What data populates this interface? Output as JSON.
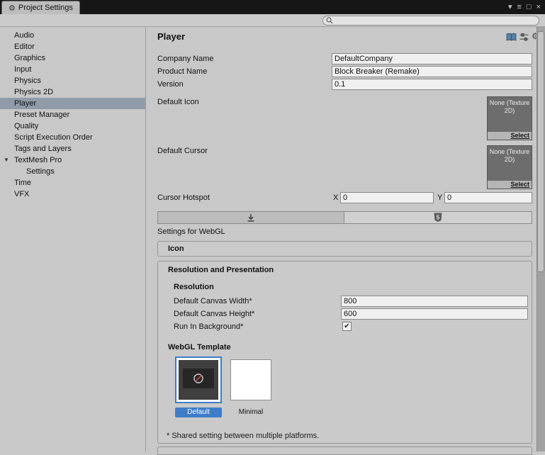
{
  "colors": {
    "selection_blue": "#3e7cc8",
    "sidebar_selection": "#8f9ba8"
  },
  "titlebar": {
    "tab_label": "Project Settings",
    "gear_glyph": "⚙",
    "caret_glyph": "▾",
    "menu_glyph": "≡",
    "maximize_glyph": "□",
    "close_glyph": "×"
  },
  "toolbar": {
    "search_value": ""
  },
  "sidebar": {
    "items": [
      {
        "label": "Audio"
      },
      {
        "label": "Editor"
      },
      {
        "label": "Graphics"
      },
      {
        "label": "Input"
      },
      {
        "label": "Physics"
      },
      {
        "label": "Physics 2D"
      },
      {
        "label": "Player"
      },
      {
        "label": "Preset Manager"
      },
      {
        "label": "Quality"
      },
      {
        "label": "Script Execution Order"
      },
      {
        "label": "Tags and Layers"
      },
      {
        "label": "TextMesh Pro",
        "foldout": "▼"
      },
      {
        "label": "Settings"
      },
      {
        "label": "Time"
      },
      {
        "label": "VFX"
      }
    ]
  },
  "main": {
    "title": "Player",
    "rows": [
      {
        "label": "Company Name",
        "value": "DefaultCompany"
      },
      {
        "label": "Product Name",
        "value": "Block Breaker (Remake)"
      },
      {
        "label": "Version",
        "value": "0.1"
      }
    ],
    "default_icon_label": "Default Icon",
    "default_cursor_label": "Default Cursor",
    "none_texture_text": "None (Texture 2D)",
    "select_label": "Select",
    "cursor_hotspot": {
      "label": "Cursor Hotspot",
      "x_label": "X",
      "x_value": "0",
      "y_label": "Y",
      "y_value": "0"
    },
    "settings_for_label": "Settings for WebGL",
    "icon_section_title": "Icon",
    "resolution": {
      "section_title": "Resolution and Presentation",
      "subsection_title": "Resolution",
      "canvas_width_label": "Default Canvas Width*",
      "canvas_width_value": "800",
      "canvas_height_label": "Default Canvas Height*",
      "canvas_height_value": "600",
      "run_in_background_label": "Run In Background*",
      "run_in_background_checked": true,
      "checkmark_glyph": "✔",
      "template_title": "WebGL Template",
      "templates": [
        {
          "label": "Default",
          "selected": true
        },
        {
          "label": "Minimal",
          "selected": false
        }
      ],
      "footnote": "* Shared setting between multiple platforms."
    }
  }
}
